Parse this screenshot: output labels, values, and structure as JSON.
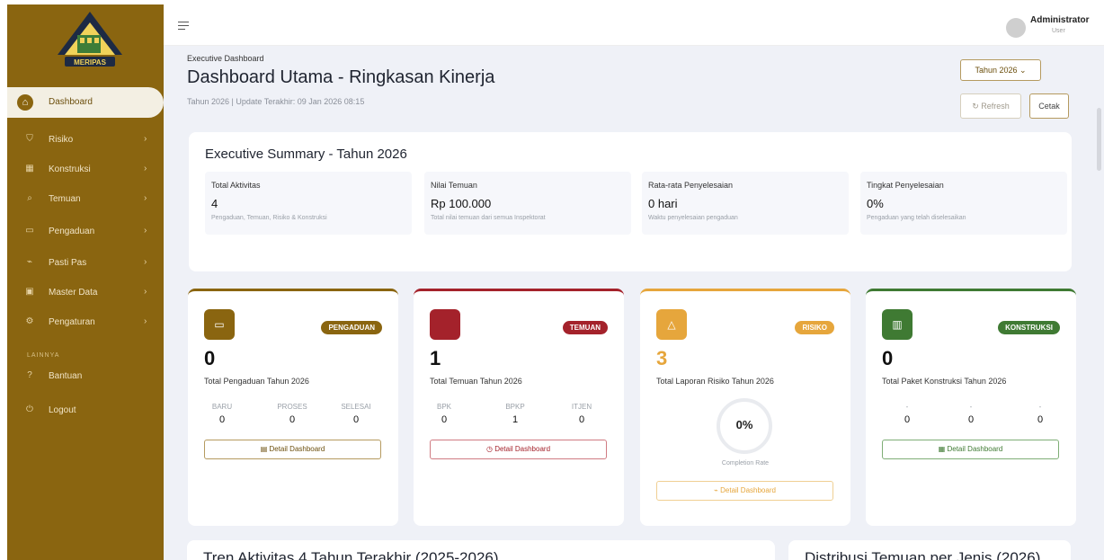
{
  "app": {
    "logo_text": "MERIPAS",
    "brand_color": "#8a6510"
  },
  "sidebar": {
    "active_item": "Dashboard",
    "items": [
      {
        "label": "Risiko"
      },
      {
        "label": "Konstruksi"
      },
      {
        "label": "Temuan"
      },
      {
        "label": "Pengaduan"
      },
      {
        "label": "Pasti Pas"
      },
      {
        "label": "Master Data"
      },
      {
        "label": "Pengaturan"
      }
    ],
    "section_label": "LAINNYA",
    "extra_items": [
      {
        "label": "Bantuan"
      },
      {
        "label": "Logout"
      }
    ]
  },
  "topbar": {
    "user_name": "Administrator",
    "user_role": "User"
  },
  "header": {
    "breadcrumb": "Executive Dashboard",
    "title": "Dashboard Utama - Ringkasan Kinerja",
    "subtitle": "Tahun 2026 | Update Terakhir: 09 Jan 2026 08:15",
    "year_select": "Tahun 2026",
    "refresh_label": "Refresh",
    "print_label": "Cetak"
  },
  "summary": {
    "title": "Executive Summary - Tahun 2026",
    "metrics": [
      {
        "label": "Total Aktivitas",
        "value": "4",
        "desc": "Pengaduan, Temuan, Risiko & Konstruksi"
      },
      {
        "label": "Nilai Temuan",
        "value": "Rp 100.000",
        "desc": "Total nilai temuan dari semua Inspektorat"
      },
      {
        "label": "Rata-rata Penyelesaian",
        "value": "0 hari",
        "desc": "Waktu penyelesaian pengaduan"
      },
      {
        "label": "Tingkat Penyelesaian",
        "value": "0%",
        "desc": "Pengaduan yang telah diselesaikan"
      }
    ]
  },
  "cards": [
    {
      "badge": "PENGADUAN",
      "color": "#8a6510",
      "count": "0",
      "desc": "Total Pengaduan Tahun 2026",
      "subs": [
        {
          "label": "BARU",
          "value": "0"
        },
        {
          "label": "PROSES",
          "value": "0"
        },
        {
          "label": "SELESAI",
          "value": "0"
        }
      ],
      "button": "Detail Dashboard"
    },
    {
      "badge": "TEMUAN",
      "color": "#a4222b",
      "count": "1",
      "desc": "Total Temuan Tahun 2026",
      "subs": [
        {
          "label": "BPK",
          "value": "0"
        },
        {
          "label": "BPKP",
          "value": "1"
        },
        {
          "label": "ITJEN",
          "value": "0"
        }
      ],
      "button": "Detail Dashboard"
    },
    {
      "badge": "RISIKO",
      "color": "#e6a63c",
      "count": "3",
      "desc": "Total Laporan Risiko Tahun 2026",
      "completion": "0%",
      "completion_label": "Completion Rate",
      "button": "Detail Dashboard"
    },
    {
      "badge": "KONSTRUKSI",
      "color": "#3f7a33",
      "count": "0",
      "desc": "Total Paket Konstruksi Tahun 2026",
      "subs": [
        {
          "label": "-",
          "value": "0"
        },
        {
          "label": "-",
          "value": "0"
        },
        {
          "label": "-",
          "value": "0"
        }
      ],
      "button": "Detail Dashboard"
    }
  ],
  "bottom": {
    "trend_title": "Tren Aktivitas 4 Tahun Terakhir (2025-2026)",
    "distribution_title": "Distribusi Temuan per Jenis (2026)"
  }
}
